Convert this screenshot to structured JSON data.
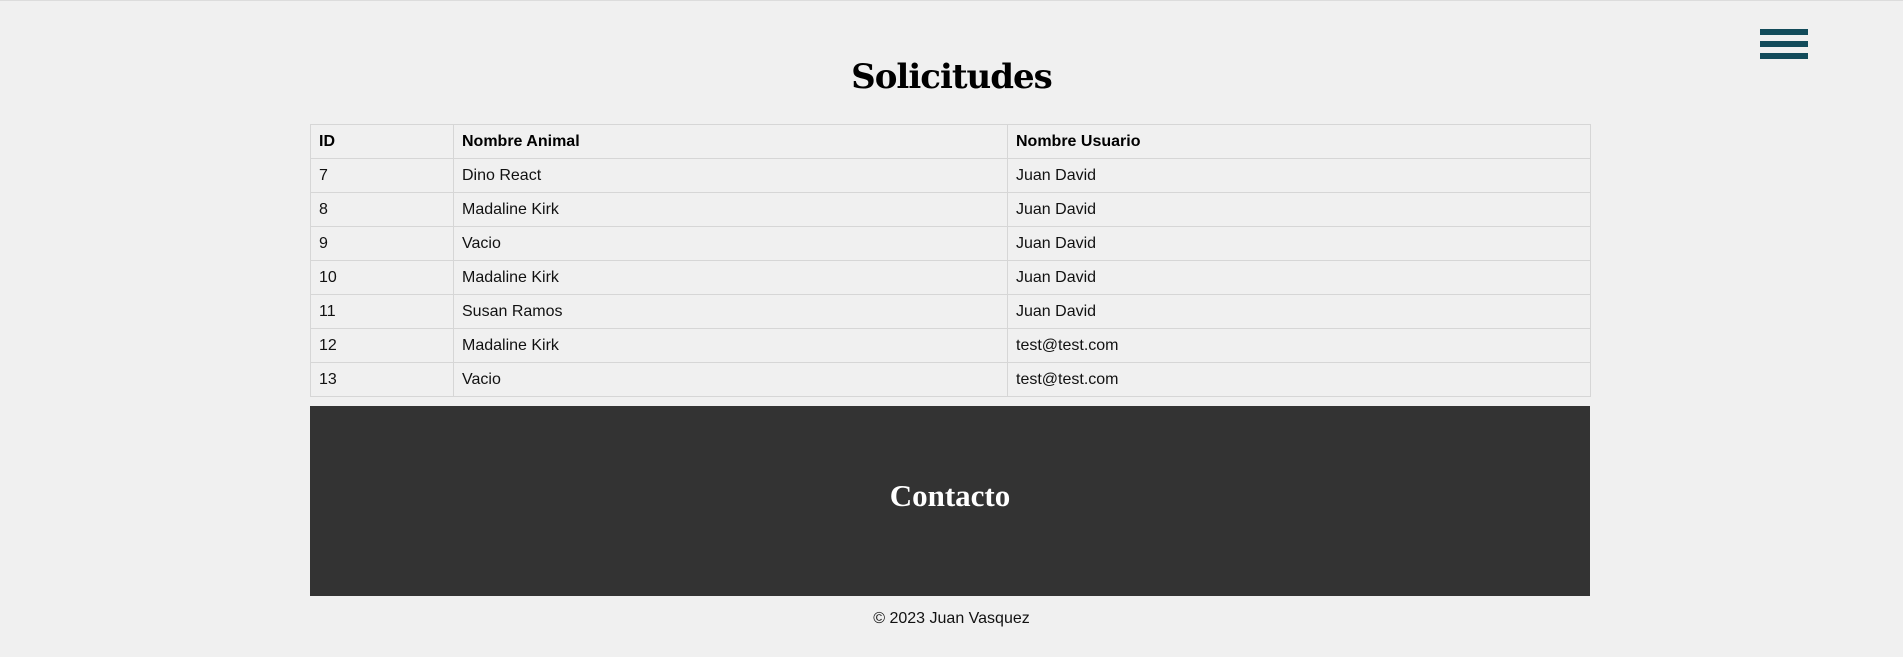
{
  "header": {
    "menu_icon": "hamburger-menu-icon",
    "menu_color": "#124b5a"
  },
  "page": {
    "title": "Solicitudes"
  },
  "table": {
    "headers": [
      "ID",
      "Nombre Animal",
      "Nombre Usuario"
    ],
    "rows": [
      [
        "7",
        "Dino React",
        "Juan David"
      ],
      [
        "8",
        "Madaline Kirk",
        "Juan David"
      ],
      [
        "9",
        "Vacio",
        "Juan David"
      ],
      [
        "10",
        "Madaline Kirk",
        "Juan David"
      ],
      [
        "11",
        "Susan Ramos",
        "Juan David"
      ],
      [
        "12",
        "Madaline Kirk",
        "test@test.com"
      ],
      [
        "13",
        "Vacio",
        "test@test.com"
      ]
    ]
  },
  "footer": {
    "title": "Contacto",
    "background": "#333333",
    "copyright": "© 2023 Juan Vasquez"
  }
}
